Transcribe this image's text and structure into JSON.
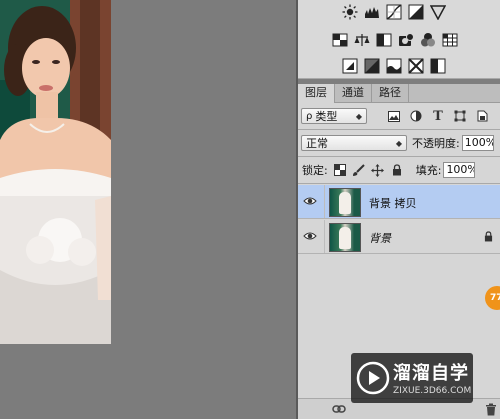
{
  "layers_panel": {
    "tabs": [
      {
        "label": "图层"
      },
      {
        "label": "通道"
      },
      {
        "label": "路径"
      }
    ],
    "filter": {
      "kind_label": "类型"
    },
    "blend": {
      "mode": "正常",
      "opacity_label": "不透明度:",
      "opacity_value": "100%"
    },
    "lock": {
      "label": "锁定:",
      "fill_label": "填充:",
      "fill_value": "100%"
    },
    "layers": [
      {
        "name": "背景 拷贝",
        "selected": true
      },
      {
        "name": "背景",
        "selected": false,
        "locked": true
      }
    ]
  },
  "badge": {
    "text": "77"
  },
  "watermark": {
    "title": "溜溜自学",
    "subtitle": "ZIXUE.3D66.COM"
  },
  "colors": {
    "selected_row": "#b4ccf2",
    "panel_bg": "#d6d6d6",
    "workspace_bg": "#7e7e7e",
    "badge": "#f0931a"
  }
}
